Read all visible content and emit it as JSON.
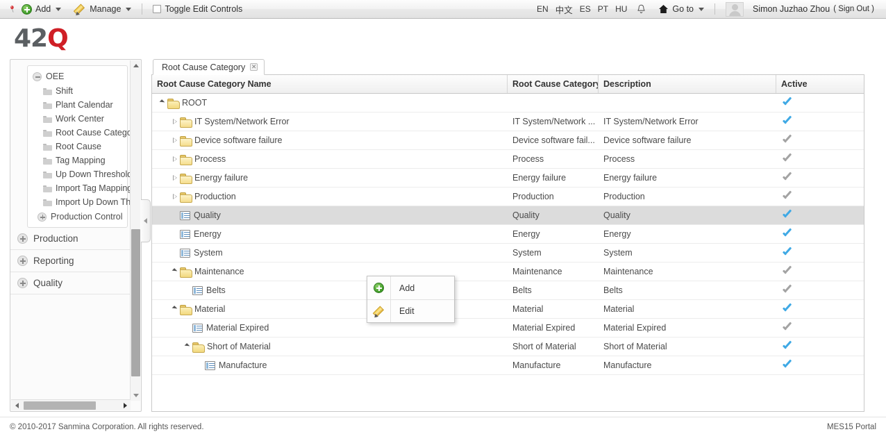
{
  "toolbar": {
    "pin_icon": "pin-icon",
    "add_label": "Add",
    "manage_label": "Manage",
    "toggle_edit_label": "Toggle Edit Controls",
    "languages": [
      "EN",
      "中文",
      "ES",
      "PT",
      "HU"
    ],
    "bell_icon": "bell-icon",
    "home_icon": "home-icon",
    "goto_label": "Go to",
    "user_name": "Simon Juzhao Zhou",
    "sign_out_label": "( Sign Out )"
  },
  "brand": {
    "logo_left": "42",
    "logo_right": "Q",
    "logo_gray": "#5b5f62",
    "logo_red": "#cf1f26"
  },
  "sidebar": {
    "group": {
      "head_label": "OEE",
      "head_state": "expanded",
      "items": [
        {
          "label": "Shift"
        },
        {
          "label": "Plant Calendar"
        },
        {
          "label": "Work Center"
        },
        {
          "label": "Root Cause Categor"
        },
        {
          "label": "Root Cause"
        },
        {
          "label": "Tag Mapping"
        },
        {
          "label": "Up Down Threshold"
        },
        {
          "label": "Import Tag Mapping"
        },
        {
          "label": "Import Up Down Th"
        }
      ],
      "footer_item": {
        "label": "Production Control",
        "state": "collapsed"
      }
    },
    "top_items": [
      {
        "label": "Production",
        "state": "collapsed"
      },
      {
        "label": "Reporting",
        "state": "collapsed"
      },
      {
        "label": "Quality",
        "state": "collapsed"
      }
    ]
  },
  "content": {
    "tab": {
      "label": "Root Cause Category",
      "close_glyph": "✕"
    },
    "columns": [
      {
        "key": "name",
        "label": "Root Cause Category Name"
      },
      {
        "key": "category",
        "label": "Root Cause Category"
      },
      {
        "key": "description",
        "label": "Description"
      },
      {
        "key": "active",
        "label": "Active"
      }
    ],
    "rows": [
      {
        "name": "ROOT",
        "indent": 0,
        "icon": "folder-open",
        "expander": "open",
        "category": "",
        "description": "",
        "active": true
      },
      {
        "name": "IT System/Network Error",
        "indent": 1,
        "icon": "folder",
        "expander": "closed",
        "category": "IT System/Network ...",
        "description": "IT System/Network Error",
        "active": true
      },
      {
        "name": "Device software failure",
        "indent": 1,
        "icon": "folder",
        "expander": "closed",
        "category": "Device software fail...",
        "description": "Device software failure",
        "active": false
      },
      {
        "name": "Process",
        "indent": 1,
        "icon": "folder",
        "expander": "closed",
        "category": "Process",
        "description": "Process",
        "active": false
      },
      {
        "name": "Energy failure",
        "indent": 1,
        "icon": "folder",
        "expander": "closed",
        "category": "Energy failure",
        "description": "Energy failure",
        "active": false
      },
      {
        "name": "Production",
        "indent": 1,
        "icon": "folder",
        "expander": "closed",
        "category": "Production",
        "description": "Production",
        "active": false
      },
      {
        "name": "Quality",
        "indent": 1,
        "icon": "leaf",
        "expander": "none",
        "category": "Quality",
        "description": "Quality",
        "active": true,
        "selected": true
      },
      {
        "name": "Energy",
        "indent": 1,
        "icon": "leaf",
        "expander": "none",
        "category": "Energy",
        "description": "Energy",
        "active": true
      },
      {
        "name": "System",
        "indent": 1,
        "icon": "leaf",
        "expander": "none",
        "category": "System",
        "description": "System",
        "active": true
      },
      {
        "name": "Maintenance",
        "indent": 1,
        "icon": "folder-open",
        "expander": "open",
        "category": "Maintenance",
        "description": "Maintenance",
        "active": false
      },
      {
        "name": "Belts",
        "indent": 2,
        "icon": "leaf",
        "expander": "none",
        "category": "Belts",
        "description": "Belts",
        "active": false
      },
      {
        "name": "Material",
        "indent": 1,
        "icon": "folder-open",
        "expander": "open",
        "category": "Material",
        "description": "Material",
        "active": true
      },
      {
        "name": "Material Expired",
        "indent": 2,
        "icon": "leaf",
        "expander": "none",
        "category": "Material Expired",
        "description": "Material Expired",
        "active": false
      },
      {
        "name": "Short of Material",
        "indent": 2,
        "icon": "folder-open",
        "expander": "open",
        "category": "Short of Material",
        "description": "Short of Material",
        "active": true
      },
      {
        "name": "Manufacture",
        "indent": 3,
        "icon": "leaf",
        "expander": "none",
        "category": "Manufacture",
        "description": "Manufacture",
        "active": true
      }
    ]
  },
  "context_menu": {
    "items": [
      {
        "label": "Add",
        "icon": "add-circle-icon"
      },
      {
        "label": "Edit",
        "icon": "pencil-icon"
      }
    ]
  },
  "footer": {
    "copyright": "© 2010-2017 Sanmina Corporation. All rights reserved.",
    "portal": "MES15 Portal"
  },
  "colors": {
    "active_check": "#3fa9e5",
    "inactive_check": "#a3a3a3",
    "selected_row": "#dcdcdc"
  }
}
